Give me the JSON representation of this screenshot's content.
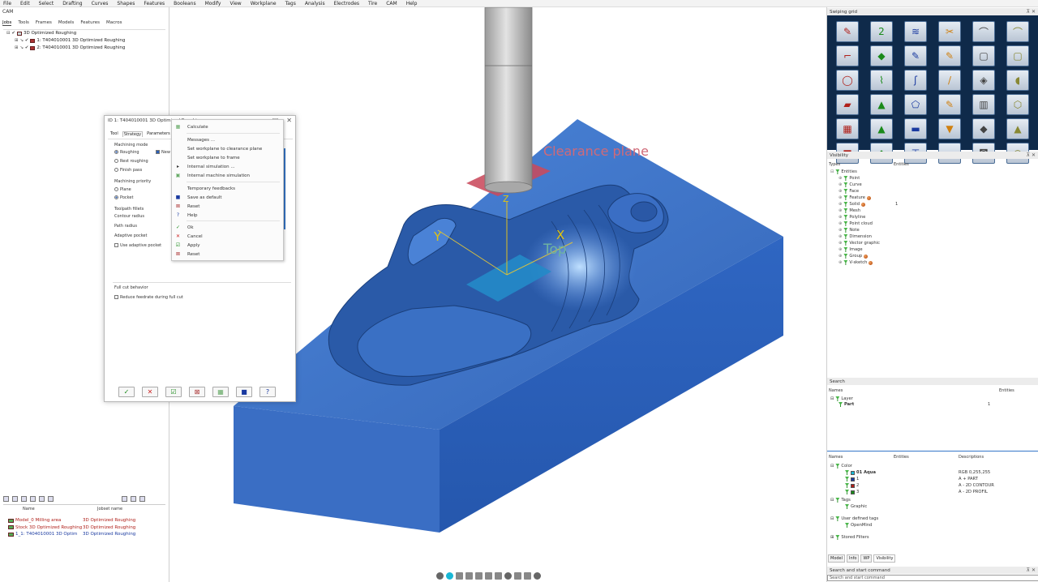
{
  "menubar": [
    "File",
    "Edit",
    "Select",
    "Drafting",
    "Curves",
    "Shapes",
    "Features",
    "Booleans",
    "Modify",
    "View",
    "Workplane",
    "Tags",
    "Analysis",
    "Electrodes",
    "Tire",
    "CAM",
    "Help"
  ],
  "left": {
    "cam_label": "CAM",
    "tabs": [
      "Jobs",
      "Tools",
      "Frames",
      "Models",
      "Features",
      "Macros"
    ],
    "tree": [
      "3D Optimized Roughing",
      "1: T404010001 3D Optimized Roughing",
      "2: T404010001 3D Optimized Roughing"
    ],
    "table": {
      "headers": [
        "Name",
        "Jobset name"
      ],
      "rows": [
        {
          "name": "Model_0 Milling area",
          "jobset": "3D Optimized Roughing",
          "color": "#b0201a"
        },
        {
          "name": "Stock 3D Optimized Roughing",
          "jobset": "3D Optimized Roughing",
          "color": "#b0201a"
        },
        {
          "name": "1_1: T404010001 3D Optim",
          "jobset": "3D Optimized Roughing",
          "color": "#1a3aa0"
        }
      ]
    }
  },
  "dialog": {
    "title": "ID 1: T404010001 3D Optimized Roughing",
    "tabs": [
      "Tool",
      "Strategy",
      "Parameters"
    ],
    "machining_mode": "Machining mode",
    "roughing": "Roughing",
    "new": "New",
    "rest_roughing": "Rest roughing",
    "finish_pass": "Finish pass",
    "machining_priority": "Machining priority",
    "plane": "Plane",
    "pocket": "Pocket",
    "toolpath_fillets": "Toolpath fillets",
    "contour_radius": "Contour radius",
    "path_radius": "Path radius",
    "adaptive_pocket": "Adaptive pocket",
    "use_adaptive_pocket": "Use adaptive pocket",
    "full_cut_behavior": "Full cut behavior",
    "reduce_feedrate": "Reduce feedrate during full cut"
  },
  "context_menu": {
    "items": [
      {
        "label": "Calculate",
        "icon": "calculate-icon",
        "glyph": "▦",
        "color": "#6a6"
      },
      {
        "label": "Messages ...",
        "icon": "",
        "glyph": "",
        "color": "#333"
      },
      {
        "label": "Set workplane to clearance plane",
        "icon": "",
        "glyph": "",
        "color": "#333"
      },
      {
        "label": "Set workplane to frame",
        "icon": "",
        "glyph": "",
        "color": "#333"
      },
      {
        "label": "Internal simulation ...",
        "icon": "play-icon",
        "glyph": "▸",
        "color": "#333"
      },
      {
        "label": "Internal machine simulation",
        "icon": "machine-simulation-icon",
        "glyph": "▣",
        "color": "#6a6"
      },
      {
        "label": "Temporary feedbacks",
        "icon": "",
        "glyph": "",
        "color": "#333"
      },
      {
        "label": "Save as default",
        "icon": "save-icon",
        "glyph": "■",
        "color": "#1a3aa0"
      },
      {
        "label": "Reset",
        "icon": "reset-icon",
        "glyph": "⊠",
        "color": "#a33"
      },
      {
        "label": "Help",
        "icon": "help-icon",
        "glyph": "?",
        "color": "#1a3aa0"
      },
      {
        "label": "Ok",
        "icon": "ok-icon",
        "glyph": "✓",
        "color": "#1a8a1a"
      },
      {
        "label": "Cancel",
        "icon": "cancel-icon",
        "glyph": "✕",
        "color": "#c22"
      },
      {
        "label": "Apply",
        "icon": "apply-icon",
        "glyph": "☑",
        "color": "#1a8a1a"
      },
      {
        "label": "Reset",
        "icon": "reset-icon",
        "glyph": "⊠",
        "color": "#a33"
      }
    ]
  },
  "viewport": {
    "clearance_plane": "Clearance plane",
    "top_label": "Top",
    "model_color": "#3f74c9",
    "clearance_color": "#c94a5c"
  },
  "right": {
    "swiping_grid_title": "Swiping grid",
    "visibility_title": "Visibility",
    "visibility_headers": [
      "Types",
      "Entities"
    ],
    "visibility_items": [
      {
        "label": "Entities",
        "count": ""
      },
      {
        "label": "Point",
        "count": ""
      },
      {
        "label": "Curve",
        "count": ""
      },
      {
        "label": "Face",
        "count": ""
      },
      {
        "label": "Feature",
        "count": ""
      },
      {
        "label": "Solid",
        "count": "1"
      },
      {
        "label": "Mesh",
        "count": ""
      },
      {
        "label": "Polyline",
        "count": ""
      },
      {
        "label": "Point cloud",
        "count": ""
      },
      {
        "label": "Note",
        "count": ""
      },
      {
        "label": "Dimension",
        "count": ""
      },
      {
        "label": "Vector graphic",
        "count": ""
      },
      {
        "label": "Image",
        "count": ""
      },
      {
        "label": "Group",
        "count": ""
      },
      {
        "label": "V-sketch",
        "count": ""
      }
    ],
    "search_title": "Search",
    "names_headers": [
      "Names",
      "Entities"
    ],
    "layer": "Layer",
    "part": "Part",
    "part_count": "1",
    "names_headers2": [
      "Names",
      "Entities",
      "Descriptions"
    ],
    "color_label": "Color",
    "color_rows": [
      {
        "name": "01 Aqua",
        "desc": "RGB 0,255,255",
        "color": "#19b8d6"
      },
      {
        "name": "1",
        "desc": "A + PART",
        "color": "#1a3aa0"
      },
      {
        "name": "2",
        "desc": "A - 2D CONTOUR",
        "color": "#b0201a"
      },
      {
        "name": "3",
        "desc": "A - 2D PROFIL",
        "color": "#1a8a1a"
      }
    ],
    "tags": "Tags",
    "graphic": "Graphic",
    "user_defined_tags": "User defined tags",
    "openmind": "OpenMind",
    "stored_filters": "Stored Filters",
    "bottom_tabs": [
      "Model",
      "Info",
      "WP",
      "Visibility"
    ],
    "search_cmd_title": "Search and start command",
    "search_cmd_placeholder": "Search and start command"
  }
}
